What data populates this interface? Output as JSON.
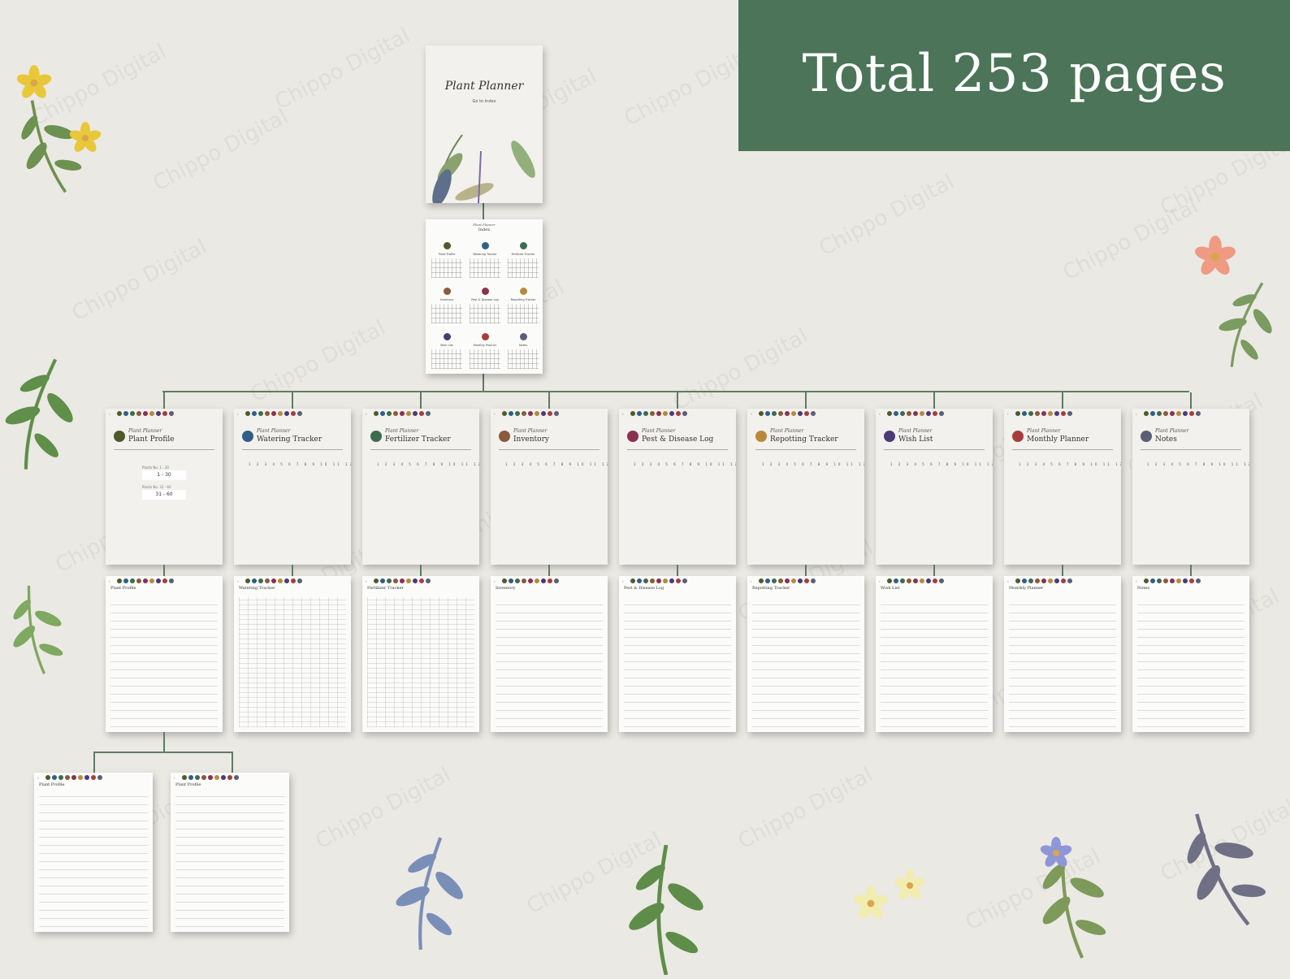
{
  "banner": {
    "text": "Total 253 pages",
    "color": "#4b7458"
  },
  "watermark": "Chippo Digital",
  "cover": {
    "title": "Plant Planner",
    "subtitle": "Go to Index"
  },
  "index": {
    "kicker": "Plant Planner",
    "title": "Index"
  },
  "sections": [
    {
      "kicker": "Plant Planner",
      "title": "Plant Profile",
      "icon": "leaf-icon",
      "color": "#4e5a2b"
    },
    {
      "kicker": "Plant Planner",
      "title": "Watering Tracker",
      "icon": "water-drop-icon",
      "color": "#2f5f86"
    },
    {
      "kicker": "Plant Planner",
      "title": "Fertilizer Tracker",
      "icon": "fertilizer-icon",
      "color": "#3d6b50"
    },
    {
      "kicker": "Plant Planner",
      "title": "Inventory",
      "icon": "inventory-icon",
      "color": "#8a5a3a"
    },
    {
      "kicker": "Plant Planner",
      "title": "Pest & Disease Log",
      "icon": "bug-icon",
      "color": "#8a3050"
    },
    {
      "kicker": "Plant Planner",
      "title": "Repotting Tracker",
      "icon": "pot-icon",
      "color": "#b8893a"
    },
    {
      "kicker": "Plant Planner",
      "title": "Wish List",
      "icon": "heart-icon",
      "color": "#4a3a7a"
    },
    {
      "kicker": "Plant Planner",
      "title": "Monthly Planner",
      "icon": "calendar-icon",
      "color": "#a83c3c"
    },
    {
      "kicker": "Plant Planner",
      "title": "Notes",
      "icon": "notes-icon",
      "color": "#5a5f75"
    }
  ],
  "profile_ranges": [
    {
      "label": "Plants No. 1 - 30",
      "value": "1 - 30"
    },
    {
      "label": "Plants No. 31 - 60",
      "value": "31 - 60"
    }
  ],
  "month_numbers": "1 2 3 4 5 6 7 8 9 10 11 12"
}
